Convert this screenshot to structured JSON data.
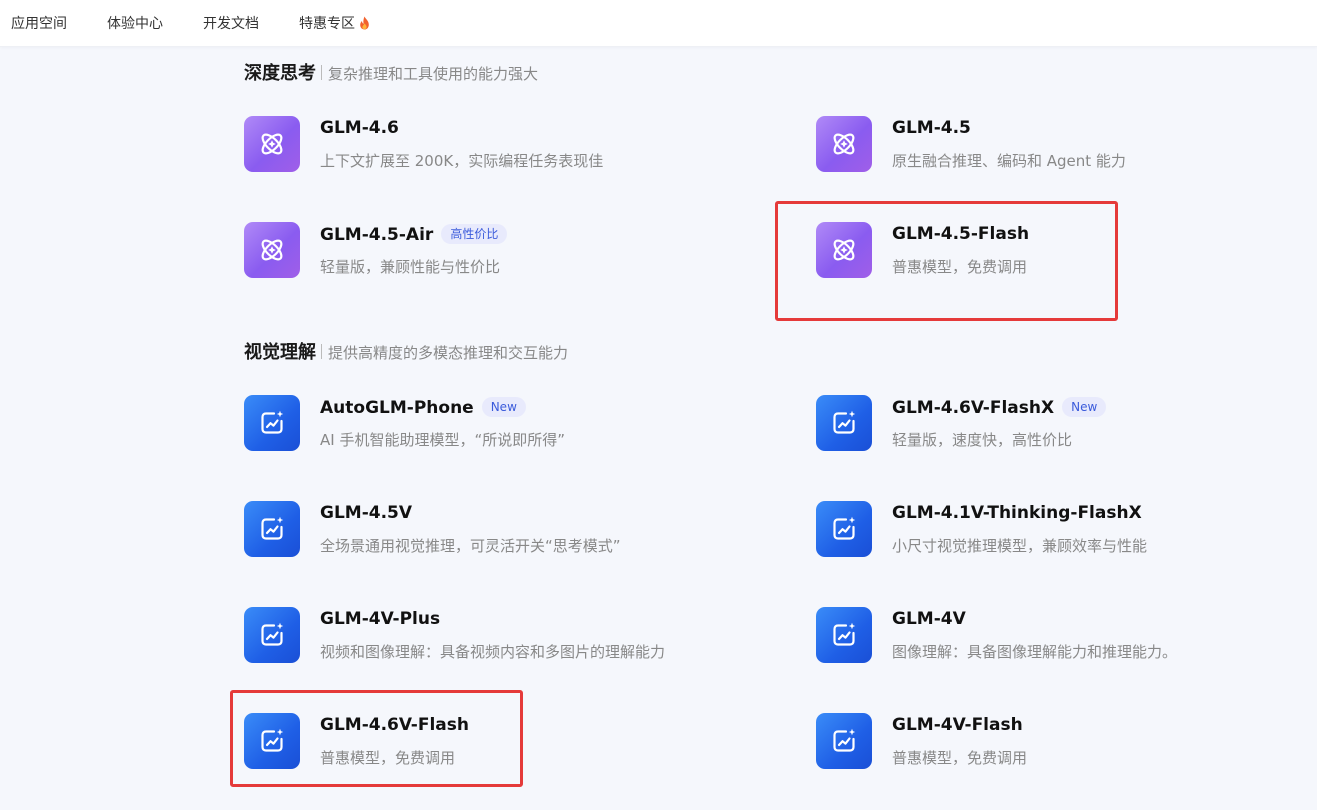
{
  "nav": {
    "items": [
      {
        "label": "应用空间"
      },
      {
        "label": "体验中心"
      },
      {
        "label": "开发文档"
      },
      {
        "label": "特惠专区",
        "icon": "fire-icon"
      }
    ]
  },
  "sections": [
    {
      "title": "深度思考",
      "subtitle": "复杂推理和工具使用的能力强大",
      "icon": "atom-icon",
      "models": [
        {
          "name": "GLM-4.6",
          "desc": "上下文扩展至 200K，实际编程任务表现佳"
        },
        {
          "name": "GLM-4.5",
          "desc": "原生融合推理、编码和 Agent 能力"
        },
        {
          "name": "GLM-4.5-Air",
          "badge": "高性价比",
          "desc": "轻量版，兼顾性能与性价比"
        },
        {
          "name": "GLM-4.5-Flash",
          "desc": "普惠模型，免费调用"
        }
      ]
    },
    {
      "title": "视觉理解",
      "subtitle": "提供高精度的多模态推理和交互能力",
      "icon": "image-chart-icon",
      "models": [
        {
          "name": "AutoGLM-Phone",
          "badge": "New",
          "desc": "AI 手机智能助理模型，“所说即所得”"
        },
        {
          "name": "GLM-4.6V-FlashX",
          "badge": "New",
          "desc": "轻量版，速度快，高性价比"
        },
        {
          "name": "GLM-4.5V",
          "desc": "全场景通用视觉推理，可灵活开关“思考模式”"
        },
        {
          "name": "GLM-4.1V-Thinking-FlashX",
          "desc": "小尺寸视觉推理模型，兼顾效率与性能"
        },
        {
          "name": "GLM-4V-Plus",
          "desc": "视频和图像理解：具备视频内容和多图片的理解能力"
        },
        {
          "name": "GLM-4V",
          "desc": "图像理解：具备图像理解能力和推理能力。"
        },
        {
          "name": "GLM-4.6V-Flash",
          "desc": "普惠模型，免费调用"
        },
        {
          "name": "GLM-4V-Flash",
          "desc": "普惠模型，免费调用"
        }
      ]
    }
  ],
  "colors": {
    "highlight": "#e53a3a",
    "badge_text": "#3b5bdb",
    "badge_bg": "#e8eafc",
    "purple_icon": "#8a5cf0",
    "blue_icon": "#1f5fe6"
  }
}
